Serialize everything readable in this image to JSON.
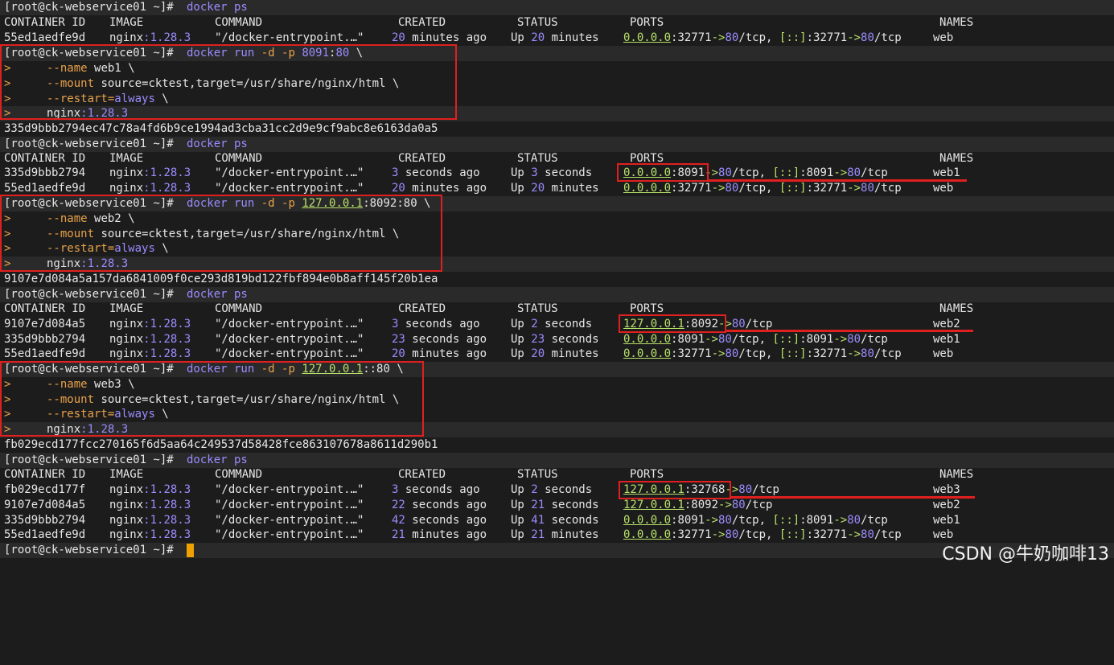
{
  "terminal": {
    "prompt": "[root@ck-webservice01 ~]#",
    "watermark": "CSDN @牛奶咖啡13",
    "headers": {
      "id": "CONTAINER ID",
      "image": "IMAGE",
      "command": "COMMAND",
      "created": "CREATED",
      "status": "STATUS",
      "ports": "PORTS",
      "names": "NAMES"
    },
    "commands": {
      "ps": "docker ps",
      "run1": {
        "base": "docker run",
        "flagd": "-d",
        "flagp": "-p",
        "port": "8091",
        "portsep": ":",
        "portc": "80",
        "bs": " \\",
        "name_opt": "--name",
        "name_val": "web1 \\",
        "mount_opt": "--mount",
        "mount_val": "source=cktest,target=/usr/share/nginx/html \\",
        "restart_opt": "--restart=",
        "restart_val": "always",
        "restart_bs": " \\",
        "image_a": "nginx",
        "image_b": ":1.28.3"
      },
      "run2": {
        "base": "docker run",
        "flagd": "-d",
        "flagp": "-p",
        "host": "127.0.0.1",
        "port": ":8092:80",
        "bs": " \\",
        "name_val": "web2 \\",
        "mount_val": "source=cktest,target=/usr/share/nginx/html \\"
      },
      "run3": {
        "base": "docker run",
        "flagd": "-d",
        "flagp": "-p",
        "host": "127.0.0.1",
        "port": "::80",
        "bs": " \\",
        "name_val": "web3 \\",
        "mount_val": "source=cktest,target=/usr/share/nginx/html \\"
      }
    },
    "hashes": {
      "web1": "335d9bbb2794ec47c78a4fd6b9ce1994ad3cba31cc2d9e9cf9abc8e6163da0a5",
      "web2": "9107e7d084a5a157da6841009f0ce293d819bd122fbf894e0b8aff145f20b1ea",
      "web3": "fb029ecd177fcc270165f6d5aa64c249537d58428fce863107678a8611d290b1"
    },
    "cont_mark": ">",
    "image_name": "nginx",
    "image_tag": ":1.28.3",
    "command_val": "\"/docker-entrypoint.…\"",
    "rows": {
      "r1": {
        "id": "55ed1aedfe9d",
        "created_n": "20",
        "created_s": " minutes ago",
        "status_a": "Up ",
        "status_n": "20",
        "status_s": " minutes",
        "names": "web"
      },
      "t2a": {
        "id": "335d9bbb2794",
        "created_n": "3",
        "created_s": " seconds ago",
        "status_a": "Up ",
        "status_n": "3",
        "status_s": " seconds",
        "names": "web1"
      },
      "t2b": {
        "id": "55ed1aedfe9d",
        "created_n": "20",
        "created_s": " minutes ago",
        "status_a": "Up ",
        "status_n": "20",
        "status_s": " minutes",
        "names": "web"
      },
      "t3a": {
        "id": "9107e7d084a5",
        "created_n": "3",
        "created_s": " seconds ago",
        "status_a": "Up ",
        "status_n": "2",
        "status_s": " seconds",
        "names": "web2"
      },
      "t3b": {
        "id": "335d9bbb2794",
        "created_n": "23",
        "created_s": " seconds ago",
        "status_a": "Up ",
        "status_n": "23",
        "status_s": " seconds",
        "names": "web1"
      },
      "t3c": {
        "id": "55ed1aedfe9d",
        "created_n": "20",
        "created_s": " minutes ago",
        "status_a": "Up ",
        "status_n": "20",
        "status_s": " minutes",
        "names": "web"
      },
      "t4a": {
        "id": "fb029ecd177f",
        "created_n": "3",
        "created_s": " seconds ago",
        "status_a": "Up ",
        "status_n": "2",
        "status_s": " seconds",
        "names": "web3"
      },
      "t4b": {
        "id": "9107e7d084a5",
        "created_n": "22",
        "created_s": " seconds ago",
        "status_a": "Up ",
        "status_n": "21",
        "status_s": " seconds",
        "names": "web2"
      },
      "t4c": {
        "id": "335d9bbb2794",
        "created_n": "42",
        "created_s": " seconds ago",
        "status_a": "Up ",
        "status_n": "41",
        "status_s": " seconds",
        "names": "web1"
      },
      "t4d": {
        "id": "55ed1aedfe9d",
        "created_n": "21",
        "created_s": " minutes ago",
        "status_a": "Up ",
        "status_n": "21",
        "status_s": " minutes",
        "names": "web"
      }
    },
    "ports": {
      "web": {
        "h4": "0.0.0.0",
        "p4": ":32771",
        "a4": "->",
        "c4": "80",
        "t4": "/tcp, ",
        "h6": "[::]",
        "p6": ":32771",
        "a6": "->",
        "c6": "80",
        "t6": "/tcp"
      },
      "web1": {
        "h4": "0.0.0.0",
        "p4": ":8091",
        "a4": "->",
        "c4": "80",
        "t4": "/tcp, ",
        "h6": "[::]",
        "p6": ":8091",
        "a6": "->",
        "c6": "80",
        "t6": "/tcp"
      },
      "web2": {
        "h4": "127.0.0.1",
        "p4": ":8092",
        "a4": "->",
        "c4": "80",
        "t4": "/tcp"
      },
      "web3": {
        "h4": "127.0.0.1",
        "p4": ":32768",
        "a4": "->",
        "c4": "80",
        "t4": "/tcp"
      }
    },
    "colors": {
      "highlight": "#e0201f",
      "cursor": "#f0a000",
      "background": "#1c1c1c"
    }
  }
}
